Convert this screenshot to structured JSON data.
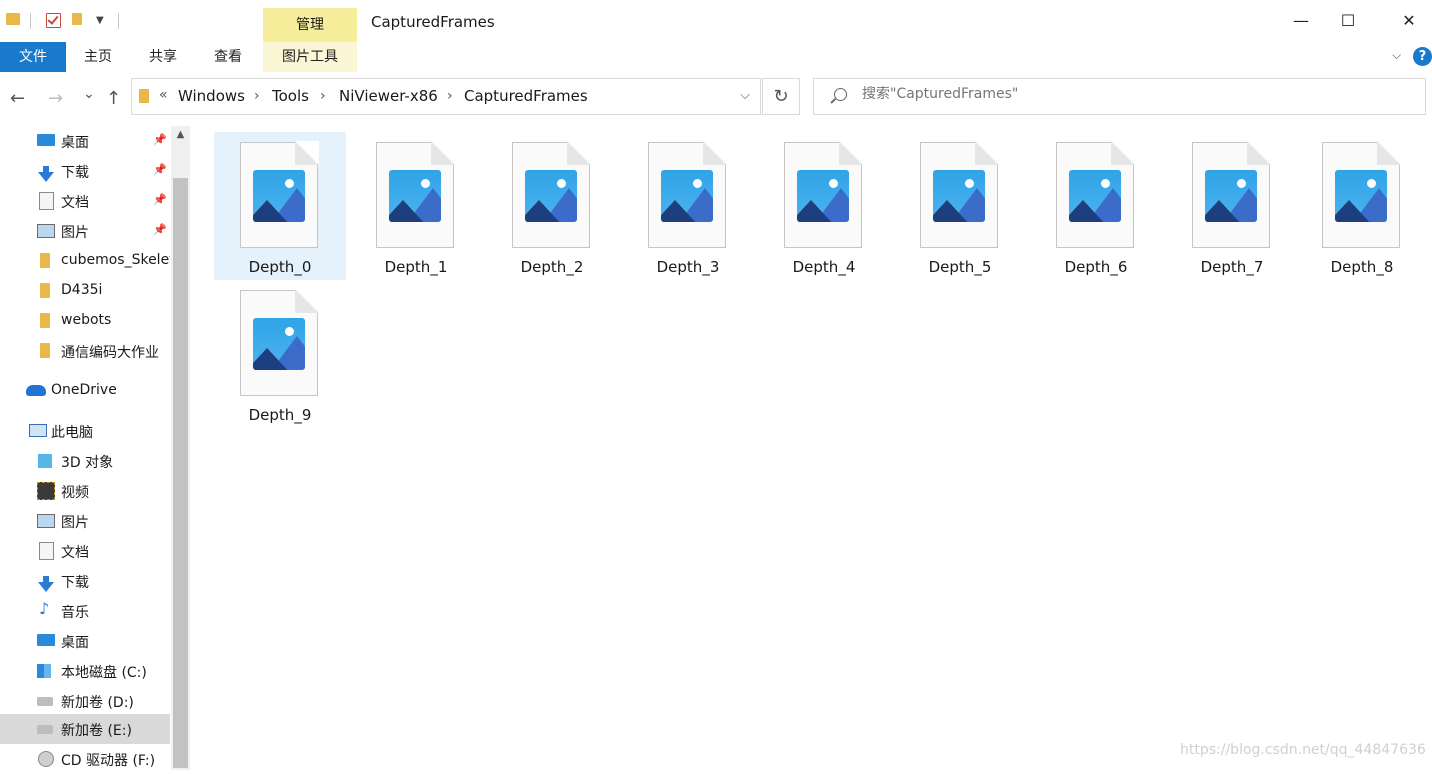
{
  "window": {
    "title": "CapturedFrames",
    "manage_tab": "管理",
    "controls": {
      "minimize": "—",
      "maximize": "☐",
      "close": "✕"
    }
  },
  "ribbon": {
    "tabs": [
      "文件",
      "主页",
      "共享",
      "查看",
      "图片工具"
    ],
    "file_color": "#1979ca",
    "contextual_color": "#f7ee9c"
  },
  "nav": {
    "back": "←",
    "forward": "→",
    "recent": "⌄",
    "up": "↑",
    "overflow": "«",
    "breadcrumb": [
      "Windows",
      "Tools",
      "NiViewer-x86",
      "CapturedFrames"
    ],
    "separator": "›",
    "refresh": "↻",
    "search_placeholder": "搜索\"CapturedFrames\""
  },
  "sidebar": {
    "quick_access": [
      {
        "label": "桌面",
        "icon": "desktop-icon",
        "pinned": true
      },
      {
        "label": "下载",
        "icon": "download-icon",
        "pinned": true
      },
      {
        "label": "文档",
        "icon": "document-icon",
        "pinned": true
      },
      {
        "label": "图片",
        "icon": "pictures-icon",
        "pinned": true
      },
      {
        "label": "cubemos_Skeleton",
        "icon": "folder-icon",
        "pinned": false
      },
      {
        "label": "D435i",
        "icon": "folder-icon",
        "pinned": false
      },
      {
        "label": "webots",
        "icon": "folder-icon",
        "pinned": false
      },
      {
        "label": "通信编码大作业",
        "icon": "folder-icon",
        "pinned": false
      }
    ],
    "onedrive": "OneDrive",
    "this_pc": "此电脑",
    "pc_items": [
      {
        "label": "3D 对象",
        "icon": "3d-objects-icon"
      },
      {
        "label": "视频",
        "icon": "video-icon"
      },
      {
        "label": "图片",
        "icon": "pictures-icon"
      },
      {
        "label": "文档",
        "icon": "document-icon"
      },
      {
        "label": "下载",
        "icon": "download-icon"
      },
      {
        "label": "音乐",
        "icon": "music-icon"
      },
      {
        "label": "桌面",
        "icon": "desktop-icon"
      },
      {
        "label": "本地磁盘 (C:)",
        "icon": "drive-c-icon"
      },
      {
        "label": "新加卷 (D:)",
        "icon": "drive-icon"
      },
      {
        "label": "新加卷 (E:)",
        "icon": "drive-icon",
        "selected": true
      },
      {
        "label": "CD 驱动器 (F:)",
        "icon": "cd-drive-icon"
      }
    ]
  },
  "files": [
    {
      "name": "Depth_0",
      "selected": true
    },
    {
      "name": "Depth_1"
    },
    {
      "name": "Depth_2"
    },
    {
      "name": "Depth_3"
    },
    {
      "name": "Depth_4"
    },
    {
      "name": "Depth_5"
    },
    {
      "name": "Depth_6"
    },
    {
      "name": "Depth_7"
    },
    {
      "name": "Depth_8"
    },
    {
      "name": "Depth_9"
    }
  ],
  "watermark": "https://blog.csdn.net/qq_44847636"
}
